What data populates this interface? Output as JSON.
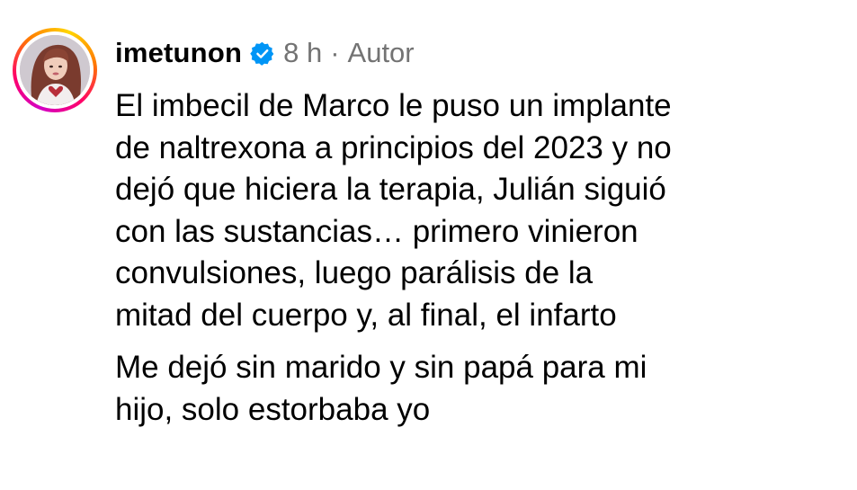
{
  "comment": {
    "username": "imetunon",
    "verified": true,
    "verified_icon": "verified-badge-icon",
    "verified_color": "#0095f6",
    "timestamp": "8 h",
    "separator": "·",
    "author_label": "Autor",
    "avatar_ring_colors": [
      "#d300c5",
      "#ff0069",
      "#ff7a00",
      "#ffd600"
    ],
    "paragraphs": [
      {
        "lines": [
          "El imbecil de Marco le puso un implante",
          "de naltrexona a principios del 2023 y no",
          "dejó que hiciera la terapia, Julián siguió",
          "con las sustancias… primero vinieron",
          "convulsiones, luego parálisis de la",
          "mitad del cuerpo y, al final, el infarto"
        ]
      },
      {
        "lines": [
          "Me dejó sin marido y sin papá para mi",
          "hijo, solo estorbaba yo"
        ]
      }
    ]
  }
}
